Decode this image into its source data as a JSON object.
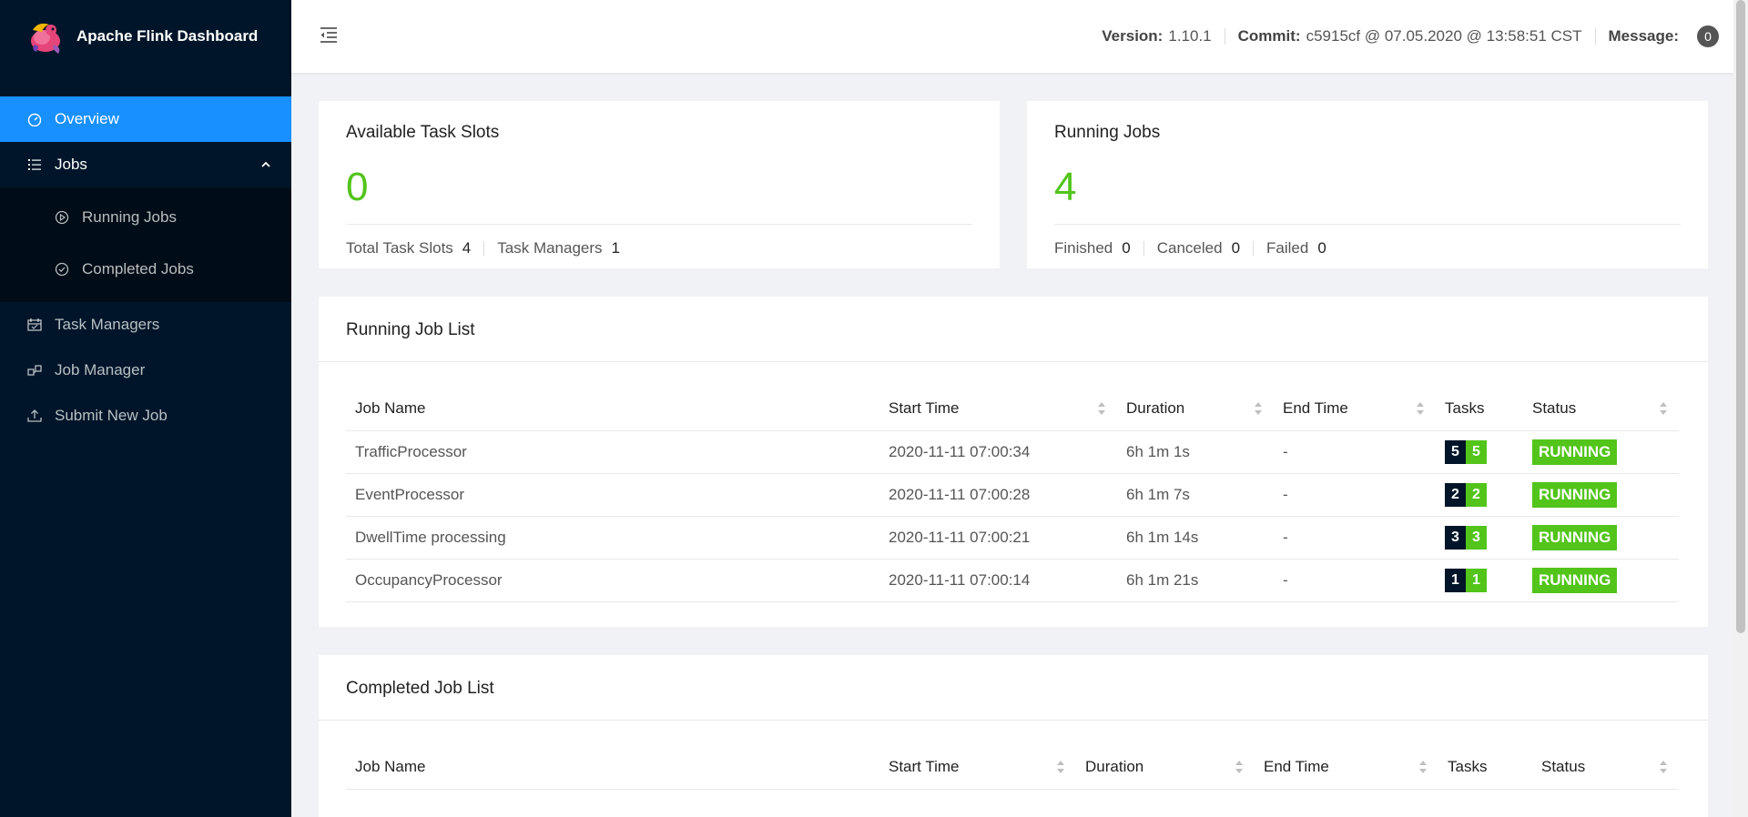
{
  "app": {
    "title": "Apache Flink Dashboard"
  },
  "sidebar": {
    "items": [
      {
        "label": "Overview",
        "icon": "dashboard-icon"
      },
      {
        "label": "Jobs",
        "icon": "list-icon",
        "children": [
          {
            "label": "Running Jobs",
            "icon": "play-circle-icon"
          },
          {
            "label": "Completed Jobs",
            "icon": "check-circle-icon"
          }
        ]
      },
      {
        "label": "Task Managers",
        "icon": "schedule-icon"
      },
      {
        "label": "Job Manager",
        "icon": "cluster-icon"
      },
      {
        "label": "Submit New Job",
        "icon": "upload-icon"
      }
    ]
  },
  "header": {
    "version_label": "Version:",
    "version": "1.10.1",
    "commit_label": "Commit:",
    "commit": "c5915cf @ 07.05.2020 @ 13:58:51 CST",
    "message_label": "Message:",
    "message_count": "0"
  },
  "slots": {
    "title": "Available Task Slots",
    "value": "0",
    "total_label": "Total Task Slots",
    "total": "4",
    "tm_label": "Task Managers",
    "tm": "1"
  },
  "running": {
    "title": "Running Jobs",
    "value": "4",
    "finished_label": "Finished",
    "finished": "0",
    "canceled_label": "Canceled",
    "canceled": "0",
    "failed_label": "Failed",
    "failed": "0"
  },
  "running_list": {
    "title": "Running Job List",
    "columns": [
      "Job Name",
      "Start Time",
      "Duration",
      "End Time",
      "Tasks",
      "Status"
    ],
    "rows": [
      {
        "name": "TrafficProcessor",
        "start": "2020-11-11 07:00:34",
        "duration": "6h 1m 1s",
        "end": "-",
        "tasks_a": "5",
        "tasks_b": "5",
        "status": "RUNNING"
      },
      {
        "name": "EventProcessor",
        "start": "2020-11-11 07:00:28",
        "duration": "6h 1m 7s",
        "end": "-",
        "tasks_a": "2",
        "tasks_b": "2",
        "status": "RUNNING"
      },
      {
        "name": "DwellTime processing",
        "start": "2020-11-11 07:00:21",
        "duration": "6h 1m 14s",
        "end": "-",
        "tasks_a": "3",
        "tasks_b": "3",
        "status": "RUNNING"
      },
      {
        "name": "OccupancyProcessor",
        "start": "2020-11-11 07:00:14",
        "duration": "6h 1m 21s",
        "end": "-",
        "tasks_a": "1",
        "tasks_b": "1",
        "status": "RUNNING"
      }
    ]
  },
  "completed_list": {
    "title": "Completed Job List",
    "columns": [
      "Job Name",
      "Start Time",
      "Duration",
      "End Time",
      "Tasks",
      "Status"
    ]
  },
  "colors": {
    "sidebar": "#001529",
    "accent": "#1890ff",
    "success": "#52c41a"
  }
}
